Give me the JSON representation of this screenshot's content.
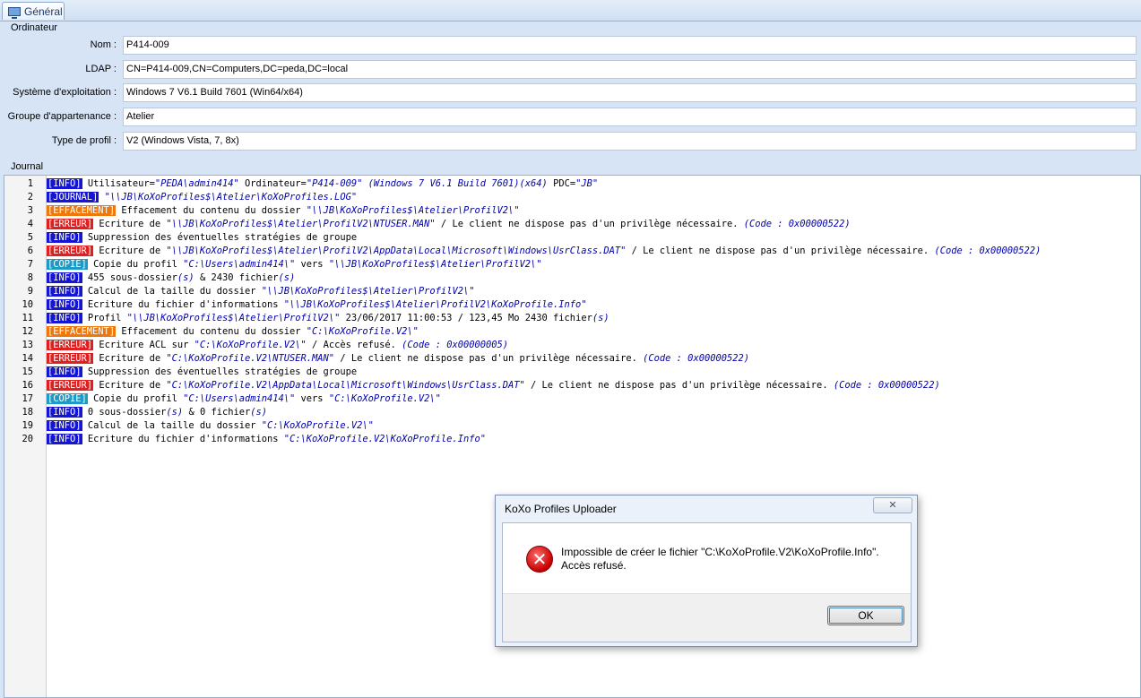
{
  "tab": {
    "label": "Général",
    "icon": "computer-icon"
  },
  "computer_group": {
    "title": "Ordinateur",
    "fields": [
      {
        "label": "Nom :",
        "value": "P414-009"
      },
      {
        "label": "LDAP :",
        "value": "CN=P414-009,CN=Computers,DC=peda,DC=local"
      },
      {
        "label": "Système d'exploitation :",
        "value": "Windows 7 V6.1 Build 7601 (Win64/x64)"
      },
      {
        "label": "Groupe d'appartenance :",
        "value": "Atelier"
      },
      {
        "label": "Type de profil :",
        "value": "V2 (Windows Vista, 7, 8x)"
      }
    ]
  },
  "journal": {
    "title": "Journal",
    "lines": [
      {
        "n": "1",
        "tag": "INFO",
        "parts": [
          [
            "t",
            "Utilisateur="
          ],
          [
            "p",
            "\"PEDA\\admin414\""
          ],
          [
            "t",
            " Ordinateur="
          ],
          [
            "p",
            "\"P414-009\" (Windows 7 V6.1 Build 7601)(x64)"
          ],
          [
            "t",
            " PDC="
          ],
          [
            "p",
            "\"JB\""
          ]
        ]
      },
      {
        "n": "2",
        "tag": "JOURNAL",
        "parts": [
          [
            "t",
            " "
          ],
          [
            "p",
            "\"\\\\JB\\KoXoProfiles$\\Atelier\\KoXoProfiles.LOG\""
          ]
        ]
      },
      {
        "n": "3",
        "tag": "EFFACEMENT",
        "parts": [
          [
            "t",
            "Effacement du contenu du dossier "
          ],
          [
            "p",
            "\"\\\\JB\\KoXoProfiles$\\Atelier\\ProfilV2\\\""
          ]
        ]
      },
      {
        "n": "4",
        "tag": "ERREUR",
        "parts": [
          [
            "t",
            "Ecriture de "
          ],
          [
            "p",
            "\"\\\\JB\\KoXoProfiles$\\Atelier\\ProfilV2\\NTUSER.MAN\""
          ],
          [
            "t",
            " / Le client ne dispose pas d'un privilège nécessaire. "
          ],
          [
            "p",
            "(Code : 0x00000522)"
          ]
        ]
      },
      {
        "n": "5",
        "tag": "INFO",
        "parts": [
          [
            "t",
            "Suppression des éventuelles stratégies de groupe"
          ]
        ]
      },
      {
        "n": "6",
        "tag": "ERREUR",
        "parts": [
          [
            "t",
            "Ecriture de "
          ],
          [
            "p",
            "\"\\\\JB\\KoXoProfiles$\\Atelier\\ProfilV2\\AppData\\Local\\Microsoft\\Windows\\UsrClass.DAT\""
          ],
          [
            "t",
            " / Le client ne dispose pas d'un privilège nécessaire. "
          ],
          [
            "p",
            "(Code : 0x00000522)"
          ]
        ]
      },
      {
        "n": "7",
        "tag": "COPIE",
        "parts": [
          [
            "t",
            "Copie du profil "
          ],
          [
            "p",
            "\"C:\\Users\\admin414\\\""
          ],
          [
            "t",
            " vers "
          ],
          [
            "p",
            "\"\\\\JB\\KoXoProfiles$\\Atelier\\ProfilV2\\\""
          ]
        ]
      },
      {
        "n": "8",
        "tag": "INFO",
        "parts": [
          [
            "t",
            "455 sous-dossier"
          ],
          [
            "p",
            "(s)"
          ],
          [
            "t",
            " & 2430 fichier"
          ],
          [
            "p",
            "(s)"
          ]
        ]
      },
      {
        "n": "9",
        "tag": "INFO",
        "parts": [
          [
            "t",
            "Calcul de la taille du dossier "
          ],
          [
            "p",
            "\"\\\\JB\\KoXoProfiles$\\Atelier\\ProfilV2\\\""
          ]
        ]
      },
      {
        "n": "10",
        "tag": "INFO",
        "parts": [
          [
            "t",
            "Ecriture du fichier d'informations "
          ],
          [
            "p",
            "\"\\\\JB\\KoXoProfiles$\\Atelier\\ProfilV2\\KoXoProfile.Info\""
          ]
        ]
      },
      {
        "n": "11",
        "tag": "INFO",
        "parts": [
          [
            "t",
            "Profil "
          ],
          [
            "p",
            "\"\\\\JB\\KoXoProfiles$\\Atelier\\ProfilV2\\\""
          ],
          [
            "t",
            " 23/06/2017 11:00:53 / 123,45 Mo 2430 fichier"
          ],
          [
            "p",
            "(s)"
          ]
        ]
      },
      {
        "n": "12",
        "tag": "EFFACEMENT",
        "parts": [
          [
            "t",
            "Effacement du contenu du dossier "
          ],
          [
            "p",
            "\"C:\\KoXoProfile.V2\\\""
          ]
        ]
      },
      {
        "n": "13",
        "tag": "ERREUR",
        "parts": [
          [
            "t",
            "Ecriture ACL sur "
          ],
          [
            "p",
            "\"C:\\KoXoProfile.V2\\\""
          ],
          [
            "t",
            " / Accès refusé. "
          ],
          [
            "p",
            "(Code : 0x00000005)"
          ]
        ]
      },
      {
        "n": "14",
        "tag": "ERREUR",
        "parts": [
          [
            "t",
            "Ecriture de "
          ],
          [
            "p",
            "\"C:\\KoXoProfile.V2\\NTUSER.MAN\""
          ],
          [
            "t",
            " / Le client ne dispose pas d'un privilège nécessaire. "
          ],
          [
            "p",
            "(Code : 0x00000522)"
          ]
        ]
      },
      {
        "n": "15",
        "tag": "INFO",
        "parts": [
          [
            "t",
            "Suppression des éventuelles stratégies de groupe"
          ]
        ]
      },
      {
        "n": "16",
        "tag": "ERREUR",
        "parts": [
          [
            "t",
            "Ecriture de "
          ],
          [
            "p",
            "\"C:\\KoXoProfile.V2\\AppData\\Local\\Microsoft\\Windows\\UsrClass.DAT\""
          ],
          [
            "t",
            " / Le client ne dispose pas d'un privilège nécessaire. "
          ],
          [
            "p",
            "(Code : 0x00000522)"
          ]
        ]
      },
      {
        "n": "17",
        "tag": "COPIE",
        "parts": [
          [
            "t",
            "Copie du profil "
          ],
          [
            "p",
            "\"C:\\Users\\admin414\\\""
          ],
          [
            "t",
            " vers "
          ],
          [
            "p",
            "\"C:\\KoXoProfile.V2\\\""
          ]
        ]
      },
      {
        "n": "18",
        "tag": "INFO",
        "parts": [
          [
            "t",
            "0 sous-dossier"
          ],
          [
            "p",
            "(s)"
          ],
          [
            "t",
            " & 0 fichier"
          ],
          [
            "p",
            "(s)"
          ]
        ]
      },
      {
        "n": "19",
        "tag": "INFO",
        "parts": [
          [
            "t",
            "Calcul de la taille du dossier "
          ],
          [
            "p",
            "\"C:\\KoXoProfile.V2\\\""
          ]
        ]
      },
      {
        "n": "20",
        "tag": "INFO",
        "parts": [
          [
            "t",
            "Ecriture du fichier d'informations "
          ],
          [
            "p",
            "\"C:\\KoXoProfile.V2\\KoXoProfile.Info\""
          ]
        ]
      }
    ]
  },
  "dialog": {
    "title": "KoXo Profiles Uploader",
    "close_symbol": "✕",
    "icon": "error-icon",
    "icon_glyph": "✕",
    "message_line1": "Impossible de créer le fichier \"C:\\KoXoProfile.V2\\KoXoProfile.Info\".",
    "message_line2": "Accès refusé.",
    "ok_label": "OK"
  },
  "colors": {
    "INFO": "#1515d4",
    "JOURNAL": "#1515d4",
    "EFFACEMENT": "#f0780a",
    "ERREUR": "#e02020",
    "COPIE": "#1d9bc6",
    "path": "#0000a8"
  }
}
